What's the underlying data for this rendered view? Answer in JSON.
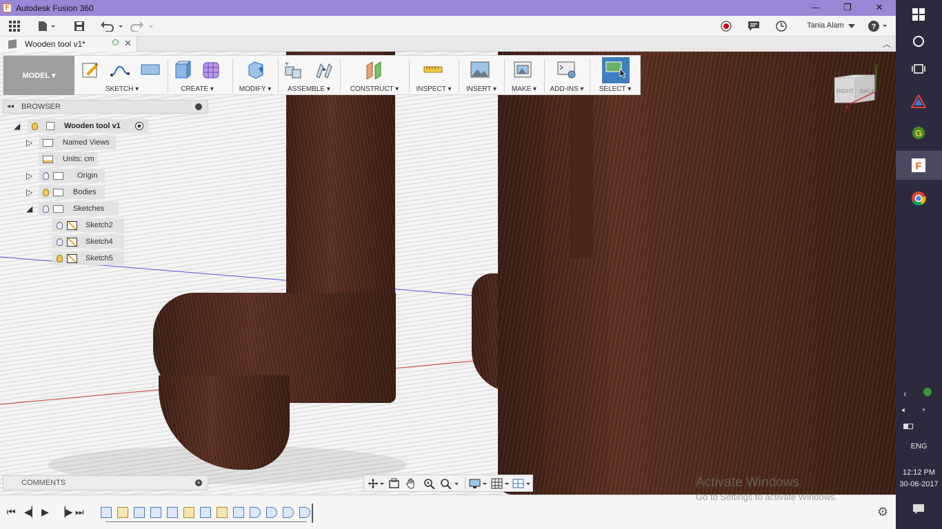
{
  "window": {
    "title": "Autodesk Fusion 360",
    "minimize": "—",
    "maximize": "❐",
    "close": "✕",
    "app_icon": "F"
  },
  "quick_access": {
    "user": "Tania Alam",
    "help": "?"
  },
  "document_tab": {
    "name": "Wooden tool v1*"
  },
  "ribbon": {
    "workspace": "MODEL ▾",
    "groups": [
      {
        "label": "SKETCH ▾"
      },
      {
        "label": "CREATE ▾"
      },
      {
        "label": "MODIFY ▾"
      },
      {
        "label": "ASSEMBLE ▾"
      },
      {
        "label": "CONSTRUCT ▾"
      },
      {
        "label": "INSPECT ▾"
      },
      {
        "label": "INSERT ▾"
      },
      {
        "label": "MAKE ▾"
      },
      {
        "label": "ADD-INS ▾"
      },
      {
        "label": "SELECT ▾"
      }
    ]
  },
  "browser": {
    "title": "BROWSER",
    "root": "Wooden tool v1",
    "items": [
      {
        "label": "Named Views"
      },
      {
        "label": "Units: cm"
      },
      {
        "label": "Origin"
      },
      {
        "label": "Bodies"
      },
      {
        "label": "Sketches"
      },
      {
        "label": "Sketch2"
      },
      {
        "label": "Sketch4"
      },
      {
        "label": "Sketch5"
      }
    ]
  },
  "comments": {
    "title": "COMMENTS"
  },
  "viewcube": {
    "right": "RIGHT",
    "back": "BACK",
    "x": "X",
    "y": "Y"
  },
  "watermark": {
    "line1": "Activate Windows",
    "line2": "Go to Settings to activate Windows."
  },
  "taskbar": {
    "language": "ENG",
    "time": "12:12 PM",
    "date": "30-06-2017"
  },
  "colors": {
    "title_bar": "#9a86d6",
    "taskbar": "#2c2b3e",
    "wood": "#4a2519",
    "selected_tool": "#3f7fbf"
  }
}
